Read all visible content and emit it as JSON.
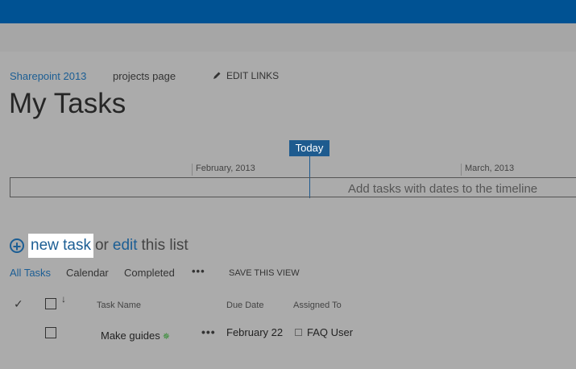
{
  "colors": {
    "suite_bar": "#005293",
    "accent": "#1e5b8f",
    "link": "#1c5e94",
    "overlay": "#ababab"
  },
  "breadcrumb": {
    "site": "Sharepoint 2013",
    "page": "projects page",
    "edit_links": "EDIT LINKS",
    "edit_icon": "pencil-icon"
  },
  "page_title": "My Tasks",
  "timeline": {
    "today_label": "Today",
    "months": [
      "February, 2013",
      "March, 2013"
    ],
    "empty_hint": "Add tasks with dates to the timeline"
  },
  "actions": {
    "new_icon": "plus-circle-icon",
    "new_task": "new task",
    "or": "or",
    "edit": "edit",
    "this_list": "this list"
  },
  "views": {
    "all_tasks": "All Tasks",
    "calendar": "Calendar",
    "completed": "Completed",
    "more": "•••",
    "save_view": "SAVE THIS VIEW"
  },
  "table": {
    "check_glyph": "✓",
    "sort_glyph": "↓",
    "columns": {
      "name": "Task Name",
      "due": "Due Date",
      "assigned": "Assigned To"
    },
    "rows": [
      {
        "name": "Make guides",
        "new_badge": "✵",
        "more": "•••",
        "due": "February 22",
        "assigned": "FAQ User"
      }
    ]
  }
}
